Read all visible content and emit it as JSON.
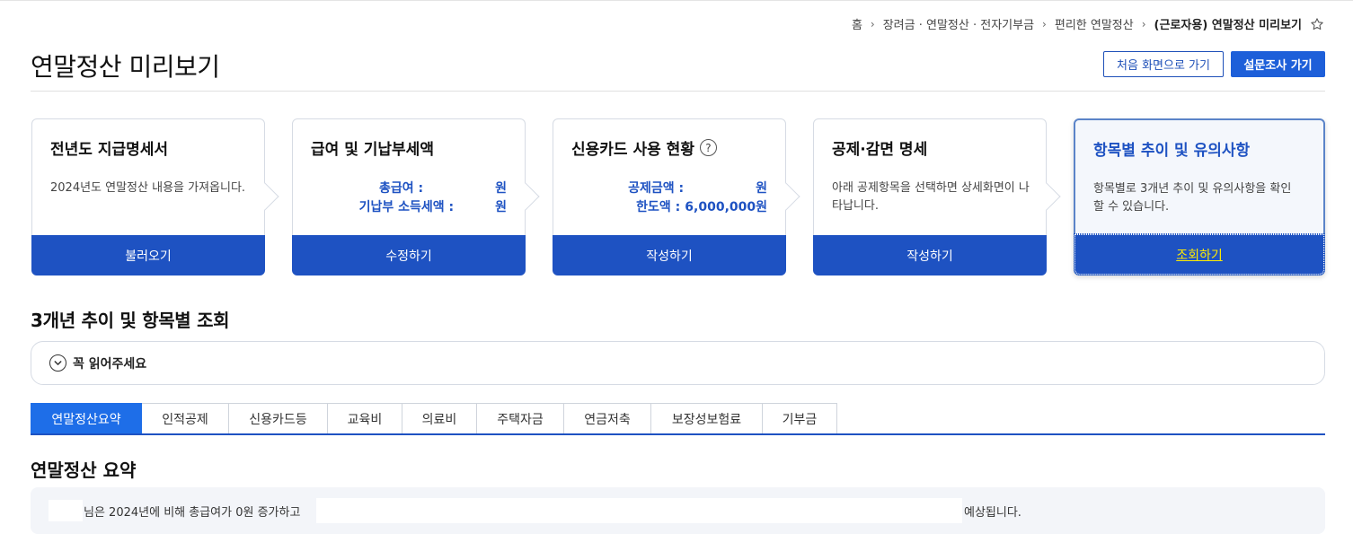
{
  "breadcrumb": {
    "items": [
      "홈",
      "장려금 · 연말정산 · 전자기부금",
      "편리한 연말정산",
      "(근로자용) 연말정산 미리보기"
    ],
    "separator": "›"
  },
  "header": {
    "title": "연말정산 미리보기",
    "btn_home": "처음 화면으로 가기",
    "btn_survey": "설문조사 가기"
  },
  "cards": [
    {
      "title": "전년도 지급명세서",
      "desc": "2024년도 연말정산 내용을 가져옵니다.",
      "button": "불러오기"
    },
    {
      "title": "급여 및 기납부세액",
      "rows": [
        {
          "label": "총급여 :",
          "unit": "원"
        },
        {
          "label": "기납부 소득세액 :",
          "unit": "원"
        }
      ],
      "button": "수정하기"
    },
    {
      "title": "신용카드 사용 현황",
      "help": "?",
      "rows": [
        {
          "label": "공제금액 :",
          "unit": "원"
        },
        {
          "label": "한도액 :",
          "value": "6,000,000원"
        }
      ],
      "button": "작성하기"
    },
    {
      "title": "공제·감면 명세",
      "desc": "아래 공제항목을 선택하면 상세화면이 나타납니다.",
      "button": "작성하기"
    },
    {
      "title": "항목별 추이 및 유의사항",
      "desc": "항목별로 3개년 추이 및 유의사항을 확인할 수 있습니다.",
      "button": "조회하기"
    }
  ],
  "section": {
    "title": "3개년 추이 및 항목별 조회",
    "notice": "꼭 읽어주세요"
  },
  "tabs": [
    "연말정산요약",
    "인적공제",
    "신용카드등",
    "교육비",
    "의료비",
    "주택자금",
    "연금저축",
    "보장성보험료",
    "기부금"
  ],
  "active_tab": 0,
  "summary": {
    "title": "연말정산 요약",
    "text_1": "님은 2024년에 비해 총급여가 0원 증가하고",
    "text_2": "예상됩니다."
  },
  "colors": {
    "primary": "#1e52c2",
    "tab_active": "#1e6ee8",
    "highlight": "#ffeb00"
  }
}
